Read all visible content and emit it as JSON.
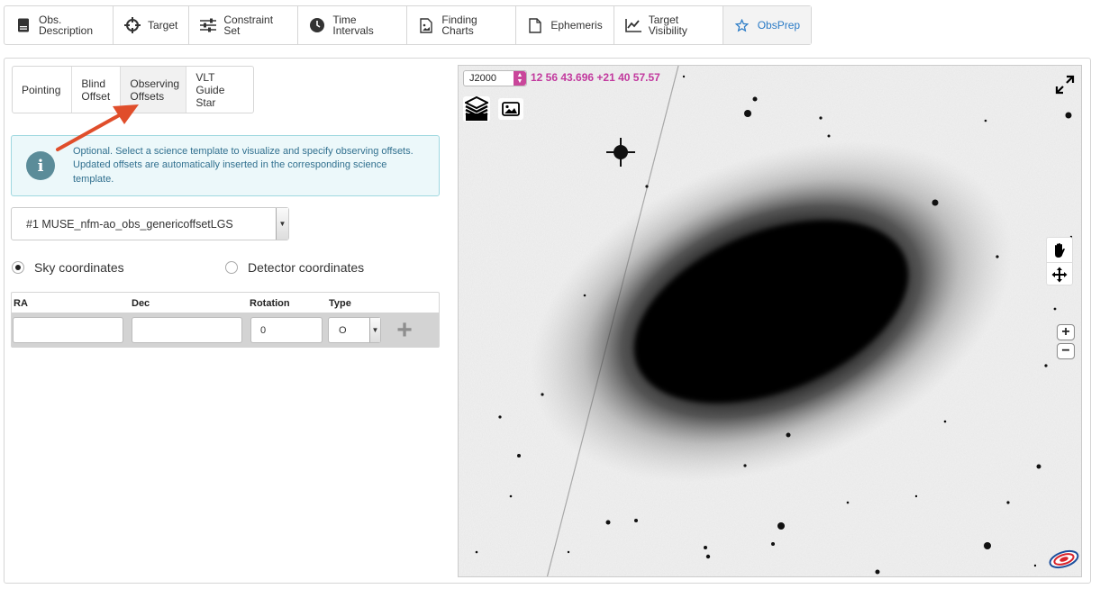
{
  "top_tabs": [
    {
      "id": "obs-description",
      "label": "Obs. Description",
      "icon": "document-icon"
    },
    {
      "id": "target",
      "label": "Target",
      "icon": "crosshair-icon"
    },
    {
      "id": "constraint-set",
      "label": "Constraint Set",
      "icon": "sliders-icon"
    },
    {
      "id": "time-intervals",
      "label": "Time Intervals",
      "icon": "clock-icon"
    },
    {
      "id": "finding-charts",
      "label": "Finding Charts",
      "icon": "image-file-icon"
    },
    {
      "id": "ephemeris",
      "label": "Ephemeris",
      "icon": "file-icon"
    },
    {
      "id": "target-visibility",
      "label": "Target Visibility",
      "icon": "line-chart-icon"
    },
    {
      "id": "obsprep",
      "label": "ObsPrep",
      "icon": "star-icon",
      "active": true
    }
  ],
  "sub_tabs": [
    {
      "id": "pointing",
      "label": "Pointing"
    },
    {
      "id": "blind-offset",
      "label": "Blind Offset"
    },
    {
      "id": "observing-offsets",
      "label": "Observing Offsets",
      "active": true
    },
    {
      "id": "vlt-guide-star",
      "label": "VLT Guide Star"
    }
  ],
  "info": {
    "text": "Optional. Select a science template to visualize and specify observing offsets. Updated offsets are automatically inserted in the corresponding science template."
  },
  "template_select": {
    "value": "#1 MUSE_nfm-ao_obs_genericoffsetLGS"
  },
  "coordinate_mode": {
    "sky_label": "Sky coordinates",
    "detector_label": "Detector coordinates",
    "selected": "sky"
  },
  "offsets_table": {
    "headers": {
      "ra": "RA",
      "dec": "Dec",
      "rotation": "Rotation",
      "type": "Type"
    },
    "row": {
      "ra": "",
      "dec": "",
      "rotation": "0",
      "type": "O"
    },
    "add_label": "+"
  },
  "viewer": {
    "frame": "J2000",
    "coordinates": "12 56 43.696 +21 40 57.57",
    "zoom_in": "+",
    "zoom_out": "−"
  },
  "colors": {
    "active_tab_text": "#2a7bc6",
    "info_bg": "#ecf8fa",
    "info_text": "#31708f",
    "coord_text": "#c2399e",
    "arrow": "#e04e2b"
  }
}
